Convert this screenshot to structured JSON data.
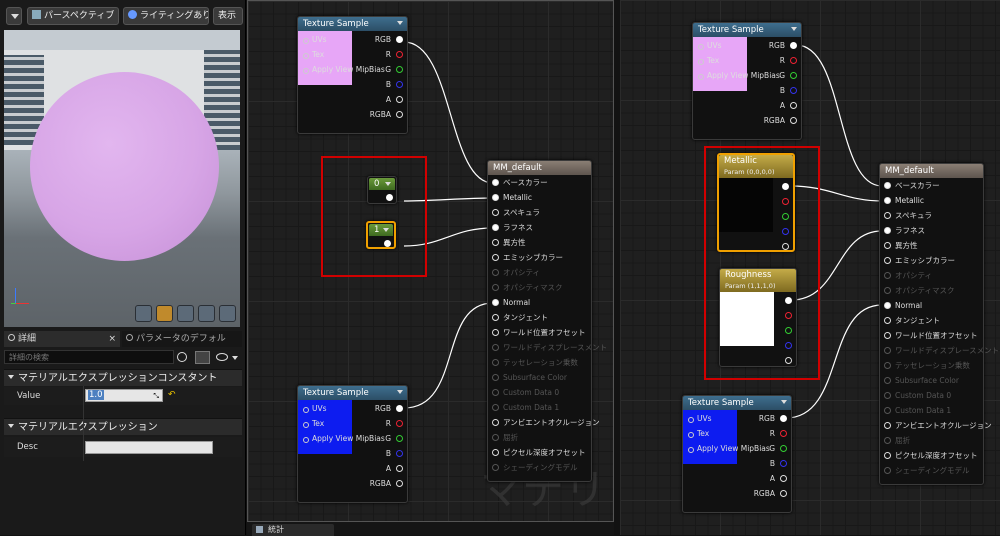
{
  "toolbar": {
    "perspective": "パースペクティブ",
    "lighting": "ライティングあり",
    "show": "表示"
  },
  "tabs": {
    "details": "詳細",
    "params": "パラメータのデフォル"
  },
  "search": {
    "placeholder": "詳細の検索"
  },
  "sections": {
    "constant": "マテリアルエクスプレッションコンスタント",
    "expression": "マテリアルエクスプレッション"
  },
  "fields": {
    "value_label": "Value",
    "value": "1.0",
    "desc_label": "Desc"
  },
  "texture_sample": {
    "title": "Texture Sample",
    "inputs": [
      "UVs",
      "Tex",
      "Apply View MipBias"
    ],
    "outputs": [
      "RGB",
      "R",
      "G",
      "B",
      "A",
      "RGBA"
    ]
  },
  "material": {
    "title": "MM_default",
    "pins": [
      "ベースカラー",
      "Metallic",
      "スペキュラ",
      "ラフネス",
      "異方性",
      "エミッシブカラー",
      "オパシティ",
      "オパシティマスク",
      "Normal",
      "タンジェント",
      "ワールド位置オフセット",
      "ワールドディスプレースメント",
      "テッセレーション乗数",
      "Subsurface Color",
      "Custom Data 0",
      "Custom Data 1",
      "アンビエントオクルージョン",
      "屈折",
      "ピクセル深度オフセット",
      "シェーディングモデル"
    ]
  },
  "constants": {
    "zero": "0",
    "one": "1"
  },
  "params": {
    "metallic_title": "Metallic",
    "metallic_sub": "Param (0,0,0,0)",
    "roughness_title": "Roughness",
    "roughness_sub": "Param (1,1,1,0)"
  },
  "watermark": "マテリ",
  "bottom_tab": "統計",
  "colors": {
    "pink": "#e7a6f7",
    "blue": "#0d1cf0",
    "material_header": "#7a6f66",
    "param_header": "#b89f3c"
  }
}
